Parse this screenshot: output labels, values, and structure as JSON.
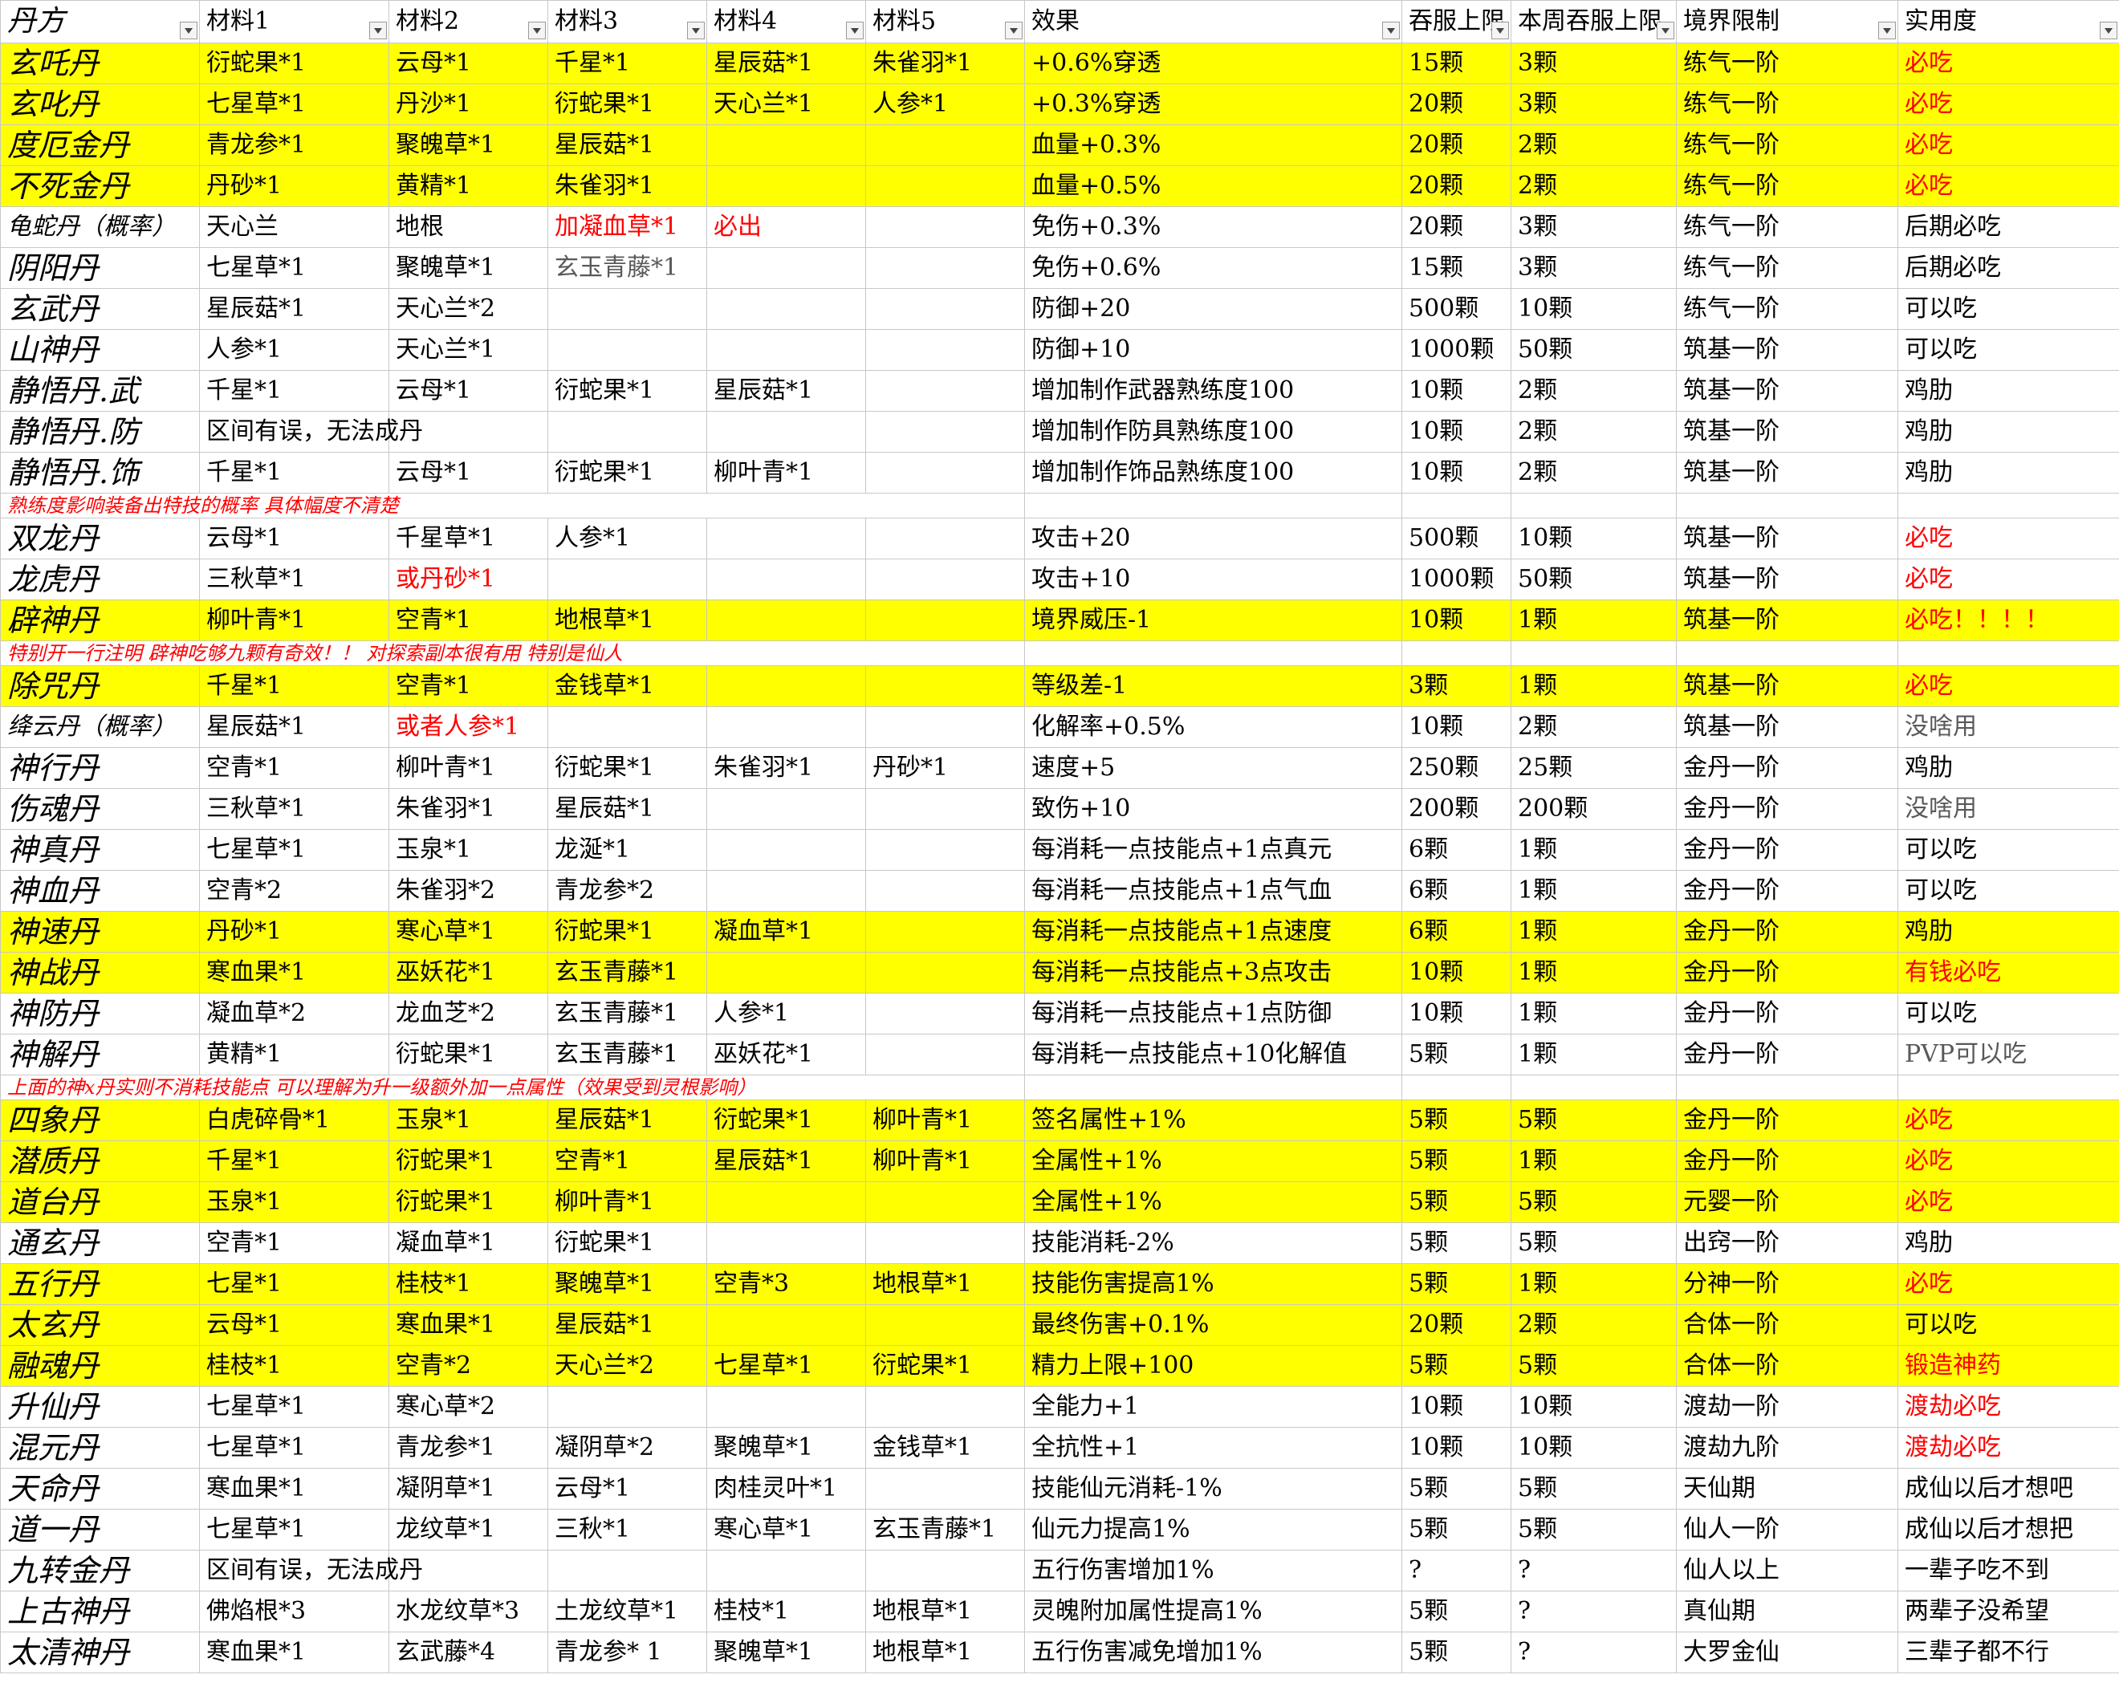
{
  "headers": [
    "丹方",
    "材料1",
    "材料2",
    "材料3",
    "材料4",
    "材料5",
    "效果",
    "吞服上限",
    "本周吞服上限",
    "境界限制",
    "实用度"
  ],
  "rows": [
    {
      "type": "row",
      "hl": true,
      "cells": [
        "玄吒丹",
        "衍蛇果*1",
        "云母*1",
        "千星*1",
        "星辰菇*1",
        "朱雀羽*1",
        "+0.6%穿透",
        "15颗",
        "3颗",
        "练气一阶",
        "必吃"
      ],
      "red": [
        10
      ]
    },
    {
      "type": "row",
      "hl": true,
      "cells": [
        "玄叱丹",
        "七星草*1",
        "丹沙*1",
        "衍蛇果*1",
        "天心兰*1",
        "人参*1",
        "+0.3%穿透",
        "20颗",
        "3颗",
        "练气一阶",
        "必吃"
      ],
      "red": [
        10
      ]
    },
    {
      "type": "row",
      "hl": true,
      "cells": [
        "度厄金丹",
        "青龙参*1",
        "聚魄草*1",
        "星辰菇*1",
        "",
        "",
        "血量+0.3%",
        "20颗",
        "2颗",
        "练气一阶",
        "必吃"
      ],
      "red": [
        10
      ]
    },
    {
      "type": "row",
      "hl": true,
      "cells": [
        "不死金丹",
        "丹砂*1",
        "黄精*1",
        "朱雀羽*1",
        "",
        "",
        "血量+0.5%",
        "20颗",
        "2颗",
        "练气一阶",
        "必吃"
      ],
      "red": [
        10
      ]
    },
    {
      "type": "row",
      "hl": false,
      "small": true,
      "cells": [
        "龟蛇丹（概率）",
        "天心兰",
        "地根",
        "加凝血草*1",
        "必出",
        "",
        "免伤+0.3%",
        "20颗",
        "3颗",
        "练气一阶",
        "后期必吃"
      ],
      "red": [
        3,
        4
      ]
    },
    {
      "type": "row",
      "hl": false,
      "cells": [
        "阴阳丹",
        "七星草*1",
        "聚魄草*1",
        "玄玉青藤*1",
        "",
        "",
        "免伤+0.6%",
        "15颗",
        "3颗",
        "练气一阶",
        "后期必吃"
      ],
      "gray": [
        3
      ]
    },
    {
      "type": "row",
      "hl": false,
      "cells": [
        "玄武丹",
        "星辰菇*1",
        "天心兰*2",
        "",
        "",
        "",
        "防御+20",
        "500颗",
        "10颗",
        "练气一阶",
        "可以吃"
      ]
    },
    {
      "type": "row",
      "hl": false,
      "cells": [
        "山神丹",
        "人参*1",
        "天心兰*1",
        "",
        "",
        "",
        "防御+10",
        "1000颗",
        "50颗",
        "筑基一阶",
        "可以吃"
      ]
    },
    {
      "type": "row",
      "hl": false,
      "cells": [
        "静悟丹.武",
        "千星*1",
        "云母*1",
        "衍蛇果*1",
        "星辰菇*1",
        "",
        "增加制作武器熟练度100",
        "10颗",
        "2颗",
        "筑基一阶",
        "鸡肋"
      ]
    },
    {
      "type": "row",
      "hl": false,
      "cells": [
        "静悟丹.防",
        "区间有误，无法成丹",
        "",
        "",
        "",
        "",
        "增加制作防具熟练度100",
        "10颗",
        "2颗",
        "筑基一阶",
        "鸡肋"
      ]
    },
    {
      "type": "row",
      "hl": false,
      "cells": [
        "静悟丹.饰",
        "千星*1",
        "云母*1",
        "衍蛇果*1",
        "柳叶青*1",
        "",
        "增加制作饰品熟练度100",
        "10颗",
        "2颗",
        "筑基一阶",
        "鸡肋"
      ]
    },
    {
      "type": "note",
      "hl": false,
      "text": "熟练度影响装备出特技的概率 具体幅度不清楚"
    },
    {
      "type": "row",
      "hl": false,
      "cells": [
        "双龙丹",
        "云母*1",
        "千星草*1",
        "人参*1",
        "",
        "",
        "攻击+20",
        "500颗",
        "10颗",
        "筑基一阶",
        "必吃"
      ],
      "red": [
        10
      ]
    },
    {
      "type": "row",
      "hl": false,
      "cells": [
        "龙虎丹",
        "三秋草*1",
        "或丹砂*1",
        "",
        "",
        "",
        "攻击+10",
        "1000颗",
        "50颗",
        "筑基一阶",
        "必吃"
      ],
      "red": [
        2,
        10
      ]
    },
    {
      "type": "row",
      "hl": true,
      "cells": [
        "辟神丹",
        "柳叶青*1",
        "空青*1",
        "地根草*1",
        "",
        "",
        "境界威压-1",
        "10颗",
        "1颗",
        "筑基一阶",
        "必吃！！！！"
      ],
      "red": [
        10
      ]
    },
    {
      "type": "note",
      "hl": false,
      "text": "特别开一行注明 辟神吃够九颗有奇效！！ 对探索副本很有用 特别是仙人"
    },
    {
      "type": "row",
      "hl": true,
      "cells": [
        "除咒丹",
        "千星*1",
        "空青*1",
        "金钱草*1",
        "",
        "",
        "等级差-1",
        "3颗",
        "1颗",
        "筑基一阶",
        "必吃"
      ],
      "red": [
        10
      ]
    },
    {
      "type": "row",
      "hl": false,
      "small": true,
      "cells": [
        "绛云丹（概率）",
        "星辰菇*1",
        "或者人参*1",
        "",
        "",
        "",
        "化解率+0.5%",
        "10颗",
        "2颗",
        "筑基一阶",
        "没啥用"
      ],
      "red": [
        2
      ],
      "gray": [
        10
      ]
    },
    {
      "type": "row",
      "hl": false,
      "cells": [
        "神行丹",
        "空青*1",
        "柳叶青*1",
        "衍蛇果*1",
        "朱雀羽*1",
        "丹砂*1",
        "速度+5",
        "250颗",
        "25颗",
        "金丹一阶",
        "鸡肋"
      ]
    },
    {
      "type": "row",
      "hl": false,
      "cells": [
        "伤魂丹",
        "三秋草*1",
        "朱雀羽*1",
        "星辰菇*1",
        "",
        "",
        "致伤+10",
        "200颗",
        "200颗",
        "金丹一阶",
        "没啥用"
      ],
      "gray": [
        10
      ]
    },
    {
      "type": "row",
      "hl": false,
      "cells": [
        "神真丹",
        "七星草*1",
        "玉泉*1",
        "龙涎*1",
        "",
        "",
        "每消耗一点技能点+1点真元",
        "6颗",
        "1颗",
        "金丹一阶",
        "可以吃"
      ]
    },
    {
      "type": "row",
      "hl": false,
      "cells": [
        "神血丹",
        "空青*2",
        "朱雀羽*2",
        "青龙参*2",
        "",
        "",
        "每消耗一点技能点+1点气血",
        "6颗",
        "1颗",
        "金丹一阶",
        "可以吃"
      ]
    },
    {
      "type": "row",
      "hl": true,
      "cells": [
        "神速丹",
        "丹砂*1",
        "寒心草*1",
        "衍蛇果*1",
        "凝血草*1",
        "",
        "每消耗一点技能点+1点速度",
        "6颗",
        "1颗",
        "金丹一阶",
        "鸡肋"
      ]
    },
    {
      "type": "row",
      "hl": true,
      "cells": [
        "神战丹",
        "寒血果*1",
        "巫妖花*1",
        "玄玉青藤*1",
        "",
        "",
        "每消耗一点技能点+3点攻击",
        "10颗",
        "1颗",
        "金丹一阶",
        "有钱必吃"
      ],
      "red": [
        10
      ]
    },
    {
      "type": "row",
      "hl": false,
      "cells": [
        "神防丹",
        "凝血草*2",
        "龙血芝*2",
        "玄玉青藤*1",
        "人参*1",
        "",
        "每消耗一点技能点+1点防御",
        "10颗",
        "1颗",
        "金丹一阶",
        "可以吃"
      ]
    },
    {
      "type": "row",
      "hl": false,
      "cells": [
        "神解丹",
        "黄精*1",
        "衍蛇果*1",
        "玄玉青藤*1",
        "巫妖花*1",
        "",
        "每消耗一点技能点+10化解值",
        "5颗",
        "1颗",
        "金丹一阶",
        "PVP可以吃"
      ],
      "gray": [
        10
      ]
    },
    {
      "type": "note",
      "hl": false,
      "text": "上面的神x丹实则不消耗技能点 可以理解为升一级额外加一点属性（效果受到灵根影响）"
    },
    {
      "type": "row",
      "hl": true,
      "cells": [
        "四象丹",
        "白虎碎骨*1",
        "玉泉*1",
        "星辰菇*1",
        "衍蛇果*1",
        "柳叶青*1",
        "签名属性+1%",
        "5颗",
        "5颗",
        "金丹一阶",
        "必吃"
      ],
      "red": [
        10
      ]
    },
    {
      "type": "row",
      "hl": true,
      "cells": [
        "潜质丹",
        "千星*1",
        "衍蛇果*1",
        "空青*1",
        "星辰菇*1",
        "柳叶青*1",
        "全属性+1%",
        "5颗",
        "1颗",
        "金丹一阶",
        "必吃"
      ],
      "red": [
        10
      ]
    },
    {
      "type": "row",
      "hl": true,
      "cells": [
        "道台丹",
        "玉泉*1",
        "衍蛇果*1",
        "柳叶青*1",
        "",
        "",
        "全属性+1%",
        "5颗",
        "5颗",
        "元婴一阶",
        "必吃"
      ],
      "red": [
        10
      ]
    },
    {
      "type": "row",
      "hl": false,
      "cells": [
        "通玄丹",
        "空青*1",
        "凝血草*1",
        "衍蛇果*1",
        "",
        "",
        "技能消耗-2%",
        "5颗",
        "5颗",
        "出窍一阶",
        "鸡肋"
      ]
    },
    {
      "type": "row",
      "hl": true,
      "cells": [
        "五行丹",
        "七星*1",
        "桂枝*1",
        "聚魄草*1",
        "空青*3",
        "地根草*1",
        "技能伤害提高1%",
        "5颗",
        "1颗",
        "分神一阶",
        "必吃"
      ],
      "red": [
        10
      ]
    },
    {
      "type": "row",
      "hl": true,
      "cells": [
        "太玄丹",
        "云母*1",
        "寒血果*1",
        "星辰菇*1",
        "",
        "",
        "最终伤害+0.1%",
        "20颗",
        "2颗",
        "合体一阶",
        "可以吃"
      ]
    },
    {
      "type": "row",
      "hl": true,
      "cells": [
        "融魂丹",
        "桂枝*1",
        "空青*2",
        "天心兰*2",
        "七星草*1",
        "衍蛇果*1",
        "精力上限+100",
        "5颗",
        "5颗",
        "合体一阶",
        "锻造神药"
      ],
      "red": [
        10
      ]
    },
    {
      "type": "row",
      "hl": false,
      "cells": [
        "升仙丹",
        "七星草*1",
        "寒心草*2",
        "",
        "",
        "",
        "全能力+1",
        "10颗",
        "10颗",
        "渡劫一阶",
        "渡劫必吃"
      ],
      "red": [
        10
      ]
    },
    {
      "type": "row",
      "hl": false,
      "cells": [
        "混元丹",
        "七星草*1",
        "青龙参*1",
        "凝阴草*2",
        "聚魄草*1",
        "金钱草*1",
        "全抗性+1",
        "10颗",
        "10颗",
        "渡劫九阶",
        "渡劫必吃"
      ],
      "red": [
        10
      ]
    },
    {
      "type": "row",
      "hl": false,
      "cells": [
        "天命丹",
        "寒血果*1",
        "凝阴草*1",
        "云母*1",
        "肉桂灵叶*1",
        "",
        "技能仙元消耗-1%",
        "5颗",
        "5颗",
        "天仙期",
        "成仙以后才想吧"
      ]
    },
    {
      "type": "row",
      "hl": false,
      "cells": [
        "道一丹",
        "七星草*1",
        "龙纹草*1",
        "三秋*1",
        "寒心草*1",
        "玄玉青藤*1",
        "仙元力提高1%",
        "5颗",
        "5颗",
        "仙人一阶",
        "成仙以后才想把"
      ]
    },
    {
      "type": "row",
      "hl": false,
      "cells": [
        "九转金丹",
        "区间有误，无法成丹",
        "",
        "",
        "",
        "",
        "五行伤害增加1%",
        "?",
        "?",
        "仙人以上",
        "一辈子吃不到"
      ]
    },
    {
      "type": "row",
      "hl": false,
      "cells": [
        "上古神丹",
        "佛焰根*3",
        "水龙纹草*3",
        "土龙纹草*1",
        "桂枝*1",
        "地根草*1",
        "灵魄附加属性提高1%",
        "5颗",
        "?",
        "真仙期",
        "两辈子没希望"
      ]
    },
    {
      "type": "row",
      "hl": false,
      "cells": [
        "太清神丹",
        "寒血果*1",
        "玄武藤*4",
        "青龙参* 1",
        "聚魄草*1",
        "地根草*1",
        "五行伤害减免增加1%",
        "5颗",
        "?",
        "大罗金仙",
        "三辈子都不行"
      ]
    }
  ]
}
